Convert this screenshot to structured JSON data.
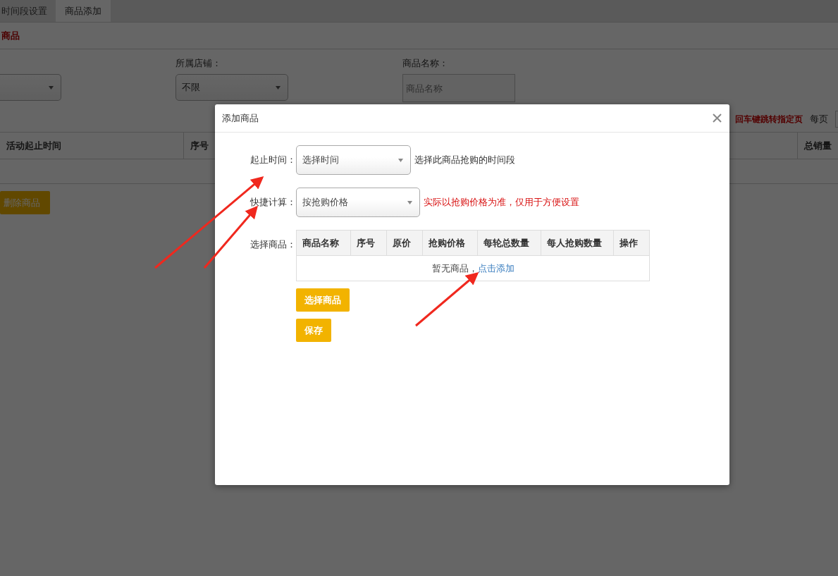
{
  "tabs": [
    {
      "label": "时间段设置",
      "selected": false
    },
    {
      "label": "商品添加",
      "selected": true
    }
  ],
  "section_title": "商品",
  "filters": [
    {
      "kind": "select"
    },
    {
      "kind": "select",
      "label": "所属店铺：",
      "value": "不限"
    },
    {
      "kind": "input",
      "label": "商品名称：",
      "placeholder": "商品名称"
    }
  ],
  "pager": {
    "hint": "回车键跳转指定页",
    "per_page_label": "每页"
  },
  "table": {
    "columns": [
      "活动起止时间",
      "序号",
      "总销量"
    ]
  },
  "delete_button": "删除商品",
  "dialog": {
    "title": "添加商品",
    "fields": [
      {
        "kind": "select",
        "label": "起止时间：",
        "value": "选择时间",
        "hint": "选择此商品抢购的时间段",
        "warning": false
      },
      {
        "kind": "select",
        "label": "快捷计算：",
        "value": "按抢购价格",
        "hint": "实际以抢购价格为准，仅用于方便设置",
        "warning": true
      },
      {
        "kind": "table",
        "label": "选择商品：",
        "columns": [
          "商品名称",
          "序号",
          "原价",
          "抢购价格",
          "每轮总数量",
          "每人抢购数量",
          "操作"
        ],
        "empty_text": "暂无商品，",
        "empty_link": "点击添加"
      }
    ],
    "buttons": [
      "选择商品",
      "保存"
    ]
  }
}
